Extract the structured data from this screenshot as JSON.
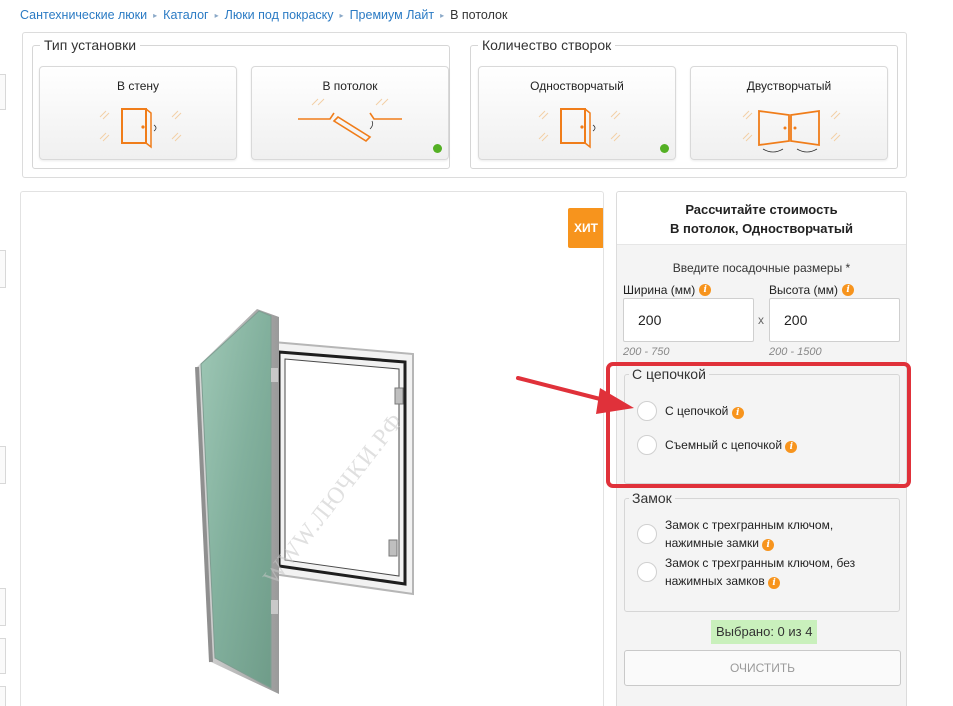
{
  "breadcrumb": [
    {
      "label": "Сантехнические люки"
    },
    {
      "label": "Каталог"
    },
    {
      "label": "Люки под покраску"
    },
    {
      "label": "Премиум Лайт"
    }
  ],
  "breadcrumb_current": "В потолок",
  "install_type": {
    "legend": "Тип установки",
    "options": [
      {
        "label": "В стену",
        "selected": false
      },
      {
        "label": "В потолок",
        "selected": true
      }
    ]
  },
  "leaf_count": {
    "legend": "Количество створок",
    "options": [
      {
        "label": "Одностворчатый",
        "selected": true
      },
      {
        "label": "Двустворчатый",
        "selected": false
      }
    ]
  },
  "product": {
    "badge": "ХИТ",
    "watermark": "WWW.ЛЮЧКИ.РФ"
  },
  "calculator": {
    "title": "Рассчитайте стоимость",
    "subtitle": "В потолок, Одностворчатый",
    "dimensions_caption": "Введите посадочные размеры *",
    "width": {
      "label": "Ширина (мм)",
      "value": "200",
      "range": "200 - 750"
    },
    "height": {
      "label": "Высота (мм)",
      "value": "200",
      "range": "200 - 1500"
    },
    "separator": "x",
    "info_glyph": "i",
    "chain_group": {
      "legend": "С цепочкой",
      "options": [
        {
          "label": "С цепочкой"
        },
        {
          "label": "Съемный с цепочкой"
        }
      ]
    },
    "lock_group": {
      "legend": "Замок",
      "options": [
        {
          "line1": "Замок с трехгранным ключом,",
          "line2": "нажимные замки"
        },
        {
          "line1": "Замок с трехгранным ключом, без",
          "line2": "нажимных замков"
        }
      ]
    },
    "selected_count": "Выбрано: 0 из 4",
    "clear_label": "Очистить"
  },
  "colors": {
    "accent_orange": "#f7941d",
    "link_blue": "#2b7bc4",
    "selected_dot": "#54b024",
    "annotation_red": "#e0313a",
    "count_bg": "#c9f0bc"
  }
}
